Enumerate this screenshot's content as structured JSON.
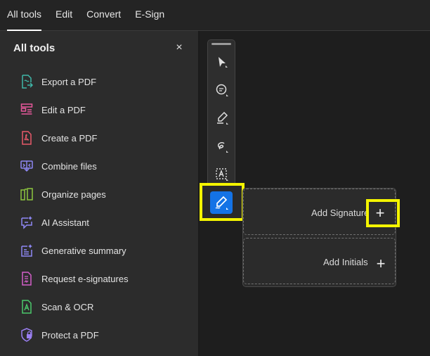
{
  "menu": {
    "tabs": [
      {
        "label": "All tools",
        "active": true
      },
      {
        "label": "Edit"
      },
      {
        "label": "Convert"
      },
      {
        "label": "E-Sign"
      }
    ]
  },
  "panel": {
    "title": "All tools",
    "close_glyph": "×",
    "tools": [
      {
        "label": "Export a PDF",
        "icon": "export-pdf-icon",
        "color": "#3fb6a8"
      },
      {
        "label": "Edit a PDF",
        "icon": "edit-pdf-icon",
        "color": "#e8589b"
      },
      {
        "label": "Create a PDF",
        "icon": "create-pdf-icon",
        "color": "#e8596a"
      },
      {
        "label": "Combine files",
        "icon": "combine-files-icon",
        "color": "#8e88f5"
      },
      {
        "label": "Organize pages",
        "icon": "organize-pages-icon",
        "color": "#8dc63f"
      },
      {
        "label": "AI Assistant",
        "icon": "ai-assistant-icon",
        "color": "#8e88f5"
      },
      {
        "label": "Generative summary",
        "icon": "generative-summary-icon",
        "color": "#8e88f5"
      },
      {
        "label": "Request e-signatures",
        "icon": "request-esignatures-icon",
        "color": "#d45ec9"
      },
      {
        "label": "Scan & OCR",
        "icon": "scan-ocr-icon",
        "color": "#4bc86b"
      },
      {
        "label": "Protect a PDF",
        "icon": "protect-pdf-icon",
        "color": "#9a7ff0"
      }
    ]
  },
  "toolbar": {
    "tools": [
      "select-arrow-icon",
      "comment-icon",
      "highlight-pen-icon",
      "freehand-draw-icon",
      "text-box-icon"
    ],
    "active_tool": "sign-pen-icon",
    "active_color": "#1473e6",
    "highlight_color": "#f4f400"
  },
  "sign_popover": {
    "add_signature_label": "Add Signature",
    "add_initials_label": "Add Initials",
    "plus_glyph": "+"
  }
}
